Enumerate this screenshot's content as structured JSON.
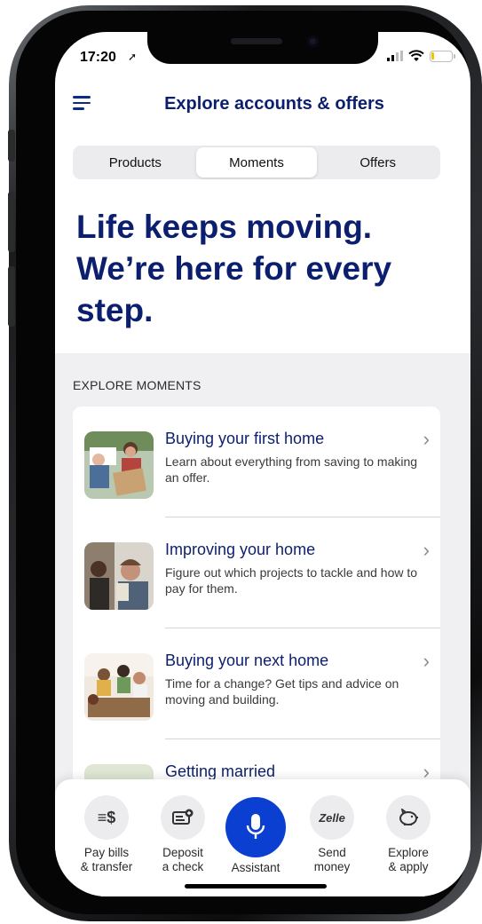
{
  "status_bar": {
    "time": "17:20",
    "location_arrow": "➚"
  },
  "header": {
    "title": "Explore accounts & offers"
  },
  "tabs": [
    {
      "label": "Products",
      "active": false
    },
    {
      "label": "Moments",
      "active": true
    },
    {
      "label": "Offers",
      "active": false
    }
  ],
  "hero": {
    "headline": "Life keeps moving. We’re here for every step."
  },
  "moments": {
    "section_label": "EXPLORE MOMENTS",
    "items": [
      {
        "title": "Buying your first home",
        "description": "Learn about everything from saving to making an offer."
      },
      {
        "title": "Improving your home",
        "description": "Figure out which projects to tackle and how to pay for them."
      },
      {
        "title": "Buying your next home",
        "description": "Time for a change? Get tips and advice on moving and building."
      },
      {
        "title": "Getting married",
        "description": ""
      }
    ]
  },
  "bottom_nav": {
    "items": [
      {
        "label": "Pay bills\n& transfer",
        "icon": "pay-bills-icon",
        "glyph": "≡$"
      },
      {
        "label": "Deposit\na check",
        "icon": "deposit-check-icon"
      },
      {
        "label": "Assistant",
        "icon": "microphone-icon"
      },
      {
        "label": "Send\nmoney",
        "icon": "zelle-icon",
        "glyph": "Zelle"
      },
      {
        "label": "Explore\n& apply",
        "icon": "piggy-bank-icon"
      }
    ]
  },
  "colors": {
    "brand_navy": "#0c1f6e",
    "accent_blue": "#0b3fd1",
    "background_grey": "#f0f0f2"
  }
}
